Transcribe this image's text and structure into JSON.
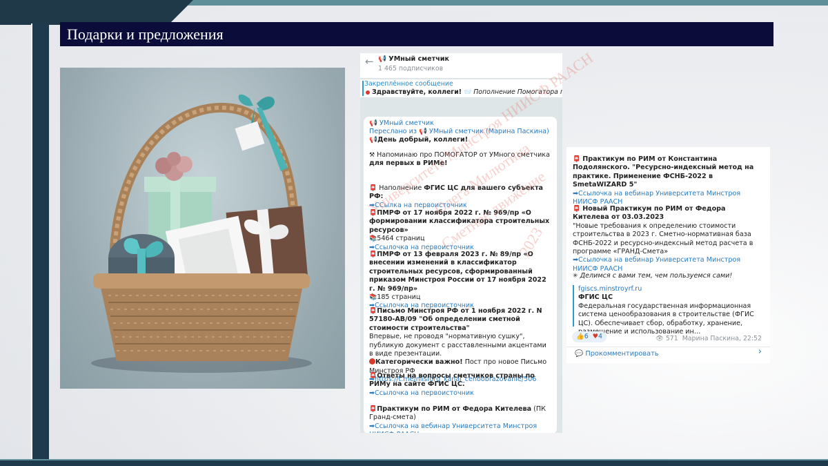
{
  "slide": {
    "title": "Подарки и предложения"
  },
  "colors": {
    "title_bg": "#0c0c3a",
    "accent": "#5f8f98",
    "link": "#2a7bc0"
  },
  "chat": {
    "channel_name": "УМный сметчик",
    "subscribers": "1 465 подписчиков",
    "pinned_title": "Закреплённое сообщение",
    "pinned_text": "Здравствуйте, коллеги!",
    "pinned_text2": "Пополнение Помогатора по типовой",
    "msg_channel": "УМный сметчик",
    "forwarded_prefix": "Переслано из",
    "forwarded_from": "УМный сметчик (Марина Паскина)",
    "greeting": "День добрый, коллеги!",
    "p1_a": "Напоминаю про ПОМОГАТОР от УМного сметчика",
    "p1_b": "для первых в РИМе!",
    "p2_a": "Наполнение",
    "p2_b": "ФГИС ЦС для вашего субъекта РФ:",
    "p2_link": "ССылка на первоисточник",
    "p3_a": "ПМРФ от 17 ноября 2022 г. № 969/пр «О формировании классификатора строительных ресурсов»",
    "p3_pages": "5464 страниц",
    "p3_link": "Ссылочка на первоисточник",
    "p4_a": "ПМРФ от 13 февраля 2023 г. № 89/пр «О внесении изменений в классификатор строительных ресурсов, сформированный приказом Минстроя России от 17 ноября 2022 г. № 969/пр»",
    "p4_pages": "185 страниц",
    "p4_link": "Ссылочка на первоисточник",
    "p5_a": "Письмо Минстроя РФ от 1 ноября 2022 г. N 57180-АВ/09  \"Об определении сметной стоимости строительства\"",
    "p5_b": "Впервые,  не проводя \"нормативную сушку\",  публикую документ с расставленными акцентами в виде презентации.",
    "p5_c_bold": "Категорически важно!",
    "p5_c": "Пост про новое Письмо Минстроя РФ",
    "p5_link": "https://t.me/niisforg_kanal_cenoobrazovanie/506",
    "p6_a": "Ответы на вопросы  сметчиков страны  по РИМу  на сайте ФГИС ЦС.",
    "p6_link": "Ссылочка на первоисточник",
    "p7_a": "Практикум по РИМ от Федора Кителева",
    "p7_b": "(ПК Гранд-смета)",
    "p7_link": "Ссылочка на вебинар Университета Минстроя  НИИСФ РААСН"
  },
  "chat2": {
    "p8_a": "Практикум по РИМ от Константина Подолянского. \"Ресурсно-индексный метод на практике. Применение ФСНБ-2022 в SmetaWIZARD 5\"",
    "p8_link": "Ссылочка на вебинар Университета Минстроя НИИСФ РААСН",
    "p9_a": "Новый Практикум по РИМ от Федора Кителева  от 03.03.2023",
    "p9_b": "\"Новые требования к определению стоимости строительства в 2023 г. Сметно-нормативная база ФСНБ-2022 и ресурсно-индексный метод расчета в программе «ГРАНД-Смета»",
    "p9_link": "Ссылочка на вебинар Университета Минстроя НИИСФ РААСН",
    "share": "Делимся с вами тем, чем пользуемся сами!",
    "preview_url": "fgiscs.minstroyrf.ru",
    "preview_title": "ФГИС ЦС",
    "preview_text": "Федеральная государственная информационная система ценообразования в строительстве (ФГИС ЦС). Обеспечивает сбор, обработку, хранение, размещение и использование ин…",
    "likes": "6",
    "hearts": "4",
    "views": "571",
    "author": "Марина Паскина,",
    "time": "22:52",
    "comment": "Прокомментировать"
  },
  "watermarks": {
    "w1": "Университета Минстроя НИИСФ РААСН",
    "w2": "Олега Милютина",
    "w3": "Сметное движение",
    "w4": "2023"
  }
}
